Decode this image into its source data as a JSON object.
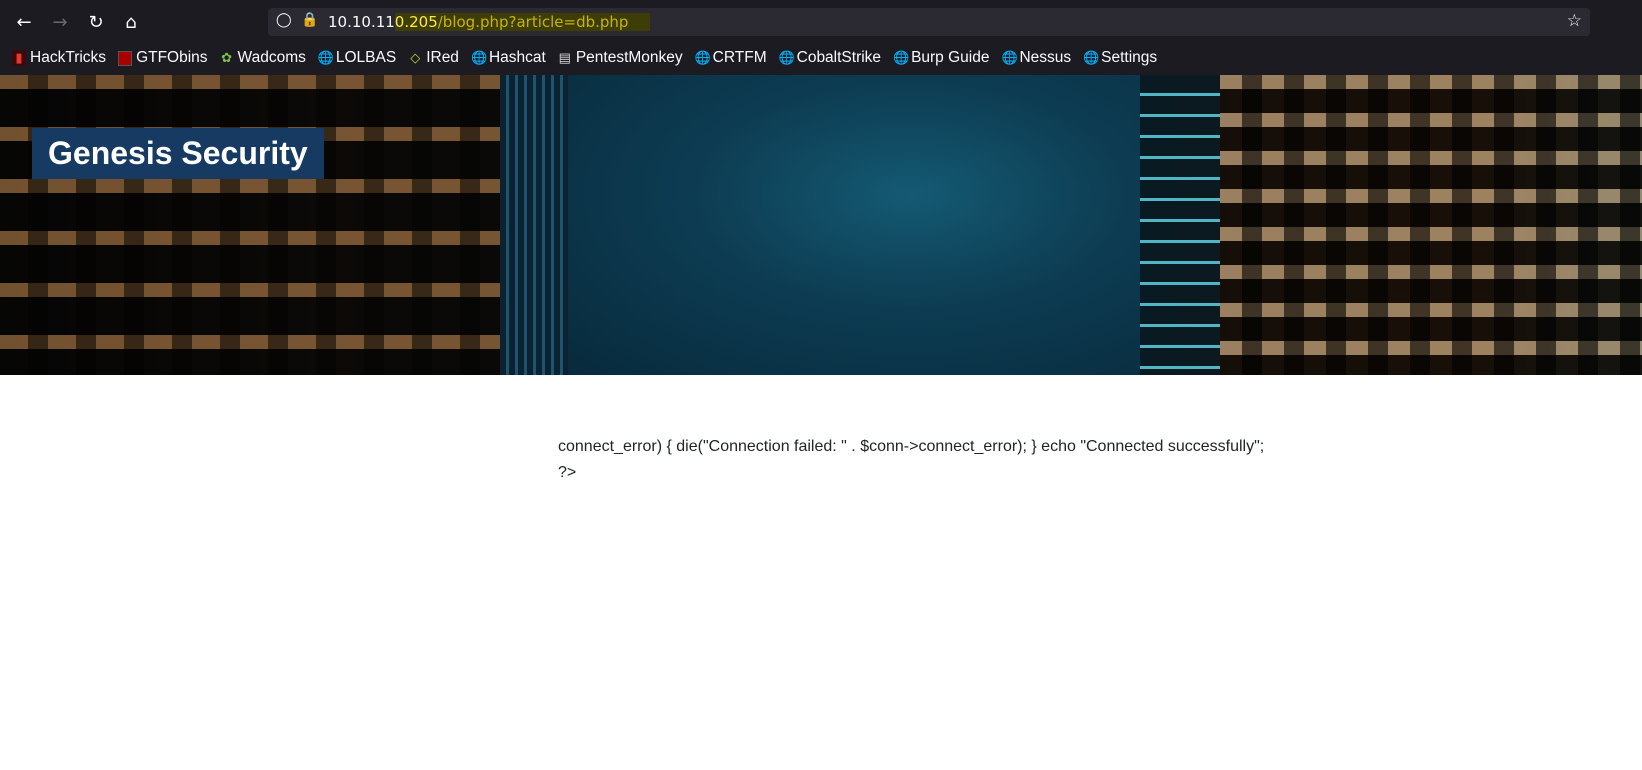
{
  "browser": {
    "url_prefix": "10.10.11",
    "url_highlight_a": "0.205",
    "url_highlight_b": "/blog.php?article=db.php",
    "bookmarks": [
      {
        "label": "HackTricks",
        "icon": "hacktricks-icon"
      },
      {
        "label": "GTFObins",
        "icon": "gtfobins-icon"
      },
      {
        "label": "Wadcoms",
        "icon": "wadcoms-icon"
      },
      {
        "label": "LOLBAS",
        "icon": "globe-icon"
      },
      {
        "label": "IRed",
        "icon": "ired-icon"
      },
      {
        "label": "Hashcat",
        "icon": "globe-icon"
      },
      {
        "label": "PentestMonkey",
        "icon": "pentestmonkey-icon"
      },
      {
        "label": "CRTFM",
        "icon": "globe-icon"
      },
      {
        "label": "CobaltStrike",
        "icon": "globe-icon"
      },
      {
        "label": "Burp Guide",
        "icon": "globe-icon"
      },
      {
        "label": "Nessus",
        "icon": "globe-icon"
      },
      {
        "label": "Settings",
        "icon": "globe-icon"
      }
    ]
  },
  "page": {
    "site_title": "Genesis Security",
    "body_line_1": "connect_error) { die(\"Connection failed: \" . $conn->connect_error); } echo \"Connected successfully\";",
    "body_line_2": "?>"
  }
}
